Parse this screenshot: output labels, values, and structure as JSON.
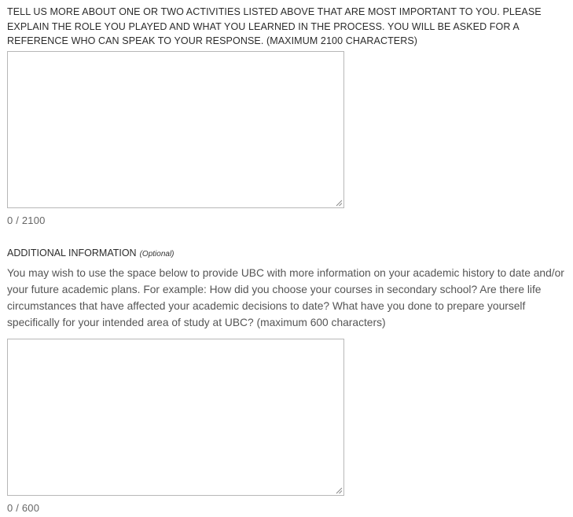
{
  "question_one": {
    "label": "TELL US MORE ABOUT ONE OR TWO ACTIVITIES LISTED ABOVE THAT ARE MOST IMPORTANT TO YOU. PLEASE EXPLAIN THE ROLE YOU PLAYED AND WHAT YOU LEARNED IN THE PROCESS. YOU WILL BE ASKED FOR A REFERENCE WHO CAN SPEAK TO YOUR RESPONSE. (MAXIMUM 2100 CHARACTERS)",
    "value": "",
    "counter": "0 / 2100"
  },
  "question_two": {
    "label": "ADDITIONAL INFORMATION",
    "optional_tag": "(Optional)",
    "help_text": "You may wish to use the space below to provide UBC with more information on your academic history to date and/or your future academic plans. For example: How did you choose your courses in secondary school? Are there life circumstances that have affected your academic decisions to date? What have you done to prepare yourself specifically for your intended area of study at UBC? (maximum 600 characters)",
    "value": "",
    "counter": "0 / 600"
  },
  "icons": {
    "resize_handle": "resize-grip-icon"
  },
  "colors": {
    "border": "#b7b7b7",
    "text": "#333333",
    "muted": "#666666"
  }
}
